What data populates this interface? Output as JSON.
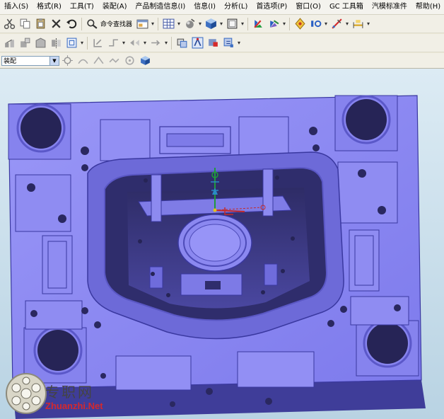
{
  "menu": {
    "items": [
      "插入(S)",
      "格式(R)",
      "工具(T)",
      "装配(A)",
      "产品制造信息(I)",
      "信息(I)",
      "分析(L)",
      "首选项(P)",
      "窗口(O)",
      "GC 工具箱",
      "汽模标准件",
      "帮助(H)"
    ]
  },
  "toolbar1": {
    "command_finder_label": "命令查找器"
  },
  "toolbar3": {
    "filter_value": "装配"
  },
  "watermark": {
    "cn": "专职网",
    "url": "Zhuanzhi.Net"
  },
  "colors": {
    "mold_top": "#8c89f3",
    "mold_side": "#5452b8",
    "cavity": "#3c3a7a",
    "background_top": "#dcebf4",
    "background_bottom": "#b9d3e3"
  }
}
